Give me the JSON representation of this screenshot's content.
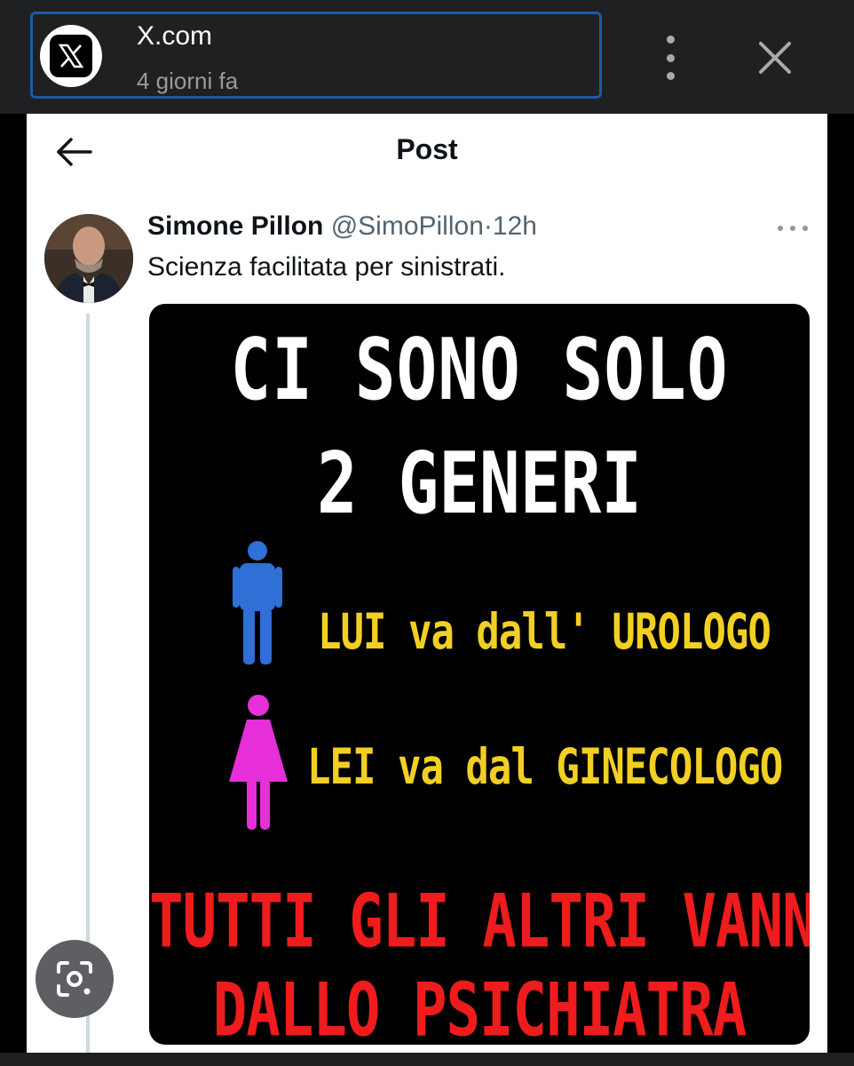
{
  "browser": {
    "site_title": "X.com",
    "site_subtitle": "4 giorni fa",
    "site_icon": "x-logo-icon",
    "menu_icon": "more-vertical-icon",
    "close_icon": "close-icon"
  },
  "post": {
    "header_title": "Post",
    "back_icon": "arrow-left-icon",
    "author_name": "Simone Pillon",
    "author_handle": "@SimoPillon",
    "separator": "·",
    "time": "12h",
    "text": "Scienza facilitata per sinistrati.",
    "more_icon": "more-horizontal-icon"
  },
  "media": {
    "line1": "CI SONO SOLO",
    "line2": "2 GENERI",
    "male_caption": "LUI va dall' UROLOGO",
    "female_caption": "LEI va dal GINECOLOGO",
    "bottom_line1": "TUTTI GLI ALTRI VANNO",
    "bottom_line2": "DALLO PSICHIATRA",
    "colors": {
      "title": "#ffffff",
      "caption": "#f2cf23",
      "bottom": "#ee1c1c",
      "male": "#2f6fd6",
      "female": "#e62fd9"
    }
  },
  "overlay": {
    "lens_icon": "lens-search-icon"
  }
}
